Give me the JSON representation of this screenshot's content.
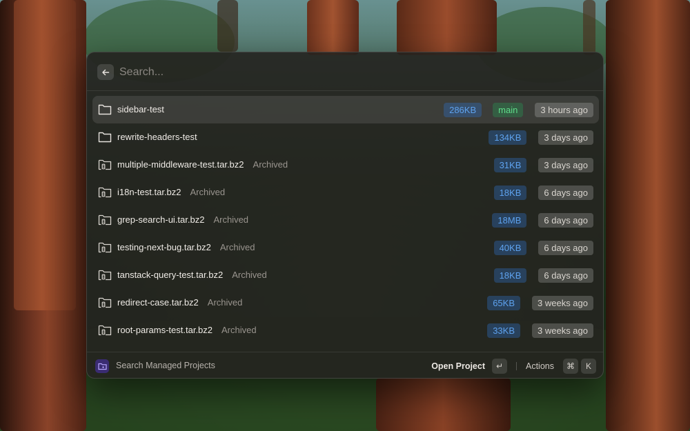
{
  "search": {
    "placeholder": "Search..."
  },
  "rows": [
    {
      "name": "sidebar-test",
      "archived": "",
      "size": "286KB",
      "branch": "main",
      "time": "3 hours ago",
      "icon": "folder-icon"
    },
    {
      "name": "rewrite-headers-test",
      "archived": "",
      "size": "134KB",
      "branch": "",
      "time": "3 days ago",
      "icon": "folder-icon"
    },
    {
      "name": "multiple-middleware-test.tar.bz2",
      "archived": "Archived",
      "size": "31KB",
      "branch": "",
      "time": "3 days ago",
      "icon": "archived-folder-icon"
    },
    {
      "name": "i18n-test.tar.bz2",
      "archived": "Archived",
      "size": "18KB",
      "branch": "",
      "time": "6 days ago",
      "icon": "archived-folder-icon"
    },
    {
      "name": "grep-search-ui.tar.bz2",
      "archived": "Archived",
      "size": "18MB",
      "branch": "",
      "time": "6 days ago",
      "icon": "archived-folder-icon"
    },
    {
      "name": "testing-next-bug.tar.bz2",
      "archived": "Archived",
      "size": "40KB",
      "branch": "",
      "time": "6 days ago",
      "icon": "archived-folder-icon"
    },
    {
      "name": "tanstack-query-test.tar.bz2",
      "archived": "Archived",
      "size": "18KB",
      "branch": "",
      "time": "6 days ago",
      "icon": "archived-folder-icon"
    },
    {
      "name": "redirect-case.tar.bz2",
      "archived": "Archived",
      "size": "65KB",
      "branch": "",
      "time": "3 weeks ago",
      "icon": "archived-folder-icon"
    },
    {
      "name": "root-params-test.tar.bz2",
      "archived": "Archived",
      "size": "33KB",
      "branch": "",
      "time": "3 weeks ago",
      "icon": "archived-folder-icon"
    }
  ],
  "footer": {
    "label": "Search Managed Projects",
    "open_project": "Open Project",
    "enter_key": "↵",
    "actions": "Actions",
    "cmd_key": "⌘",
    "k_key": "K"
  },
  "colors": {
    "size_text": "#5ea2ee",
    "branch_text": "#5fdd8a",
    "logo_bg": "#3a2c72"
  }
}
